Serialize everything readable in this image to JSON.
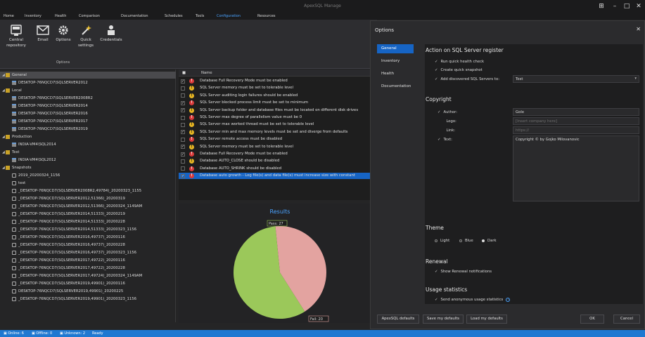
{
  "app": {
    "title": "ApexSQL Manage"
  },
  "menu": [
    "Home",
    "Inventory",
    "Health",
    "Comparison",
    "Documentation",
    "Schedules",
    "Tools",
    "Configuration",
    "Resources"
  ],
  "ribbon": {
    "buttons": [
      {
        "label_1": "Central",
        "label_2": "repository",
        "icon": "database-icon"
      },
      {
        "label_1": "Email",
        "label_2": "",
        "icon": "mail-icon"
      },
      {
        "label_1": "Options",
        "label_2": "",
        "icon": "gear-icon"
      },
      {
        "label_1": "Quick",
        "label_2": "settings",
        "icon": "magic-wand-icon"
      },
      {
        "label_1": "Credentials",
        "label_2": "",
        "icon": "user-key-icon"
      }
    ],
    "group_label": "Options"
  },
  "tree": [
    {
      "label": "General",
      "type": "group",
      "indent": 0,
      "selected": true
    },
    {
      "label": "DESKTOP-76NQCD7\\SQLSERVER2012",
      "type": "server",
      "indent": 1
    },
    {
      "label": "Local",
      "type": "group",
      "indent": 0
    },
    {
      "label": "DESKTOP-76NQCD7\\SQLSERVER2008R2",
      "type": "server",
      "indent": 1
    },
    {
      "label": "DESKTOP-76NQCD7\\SQLSERVER2014",
      "type": "server",
      "indent": 1
    },
    {
      "label": "DESKTOP-76NQCD7\\SQLSERVER2016",
      "type": "server",
      "indent": 1
    },
    {
      "label": "DESKTOP-76NQCD7\\SQLSERVER2017",
      "type": "server",
      "indent": 1
    },
    {
      "label": "DESKTOP-76NQCD7\\SQLSERVER2019",
      "type": "server",
      "indent": 1
    },
    {
      "label": "Production",
      "type": "group",
      "indent": 0
    },
    {
      "label": "INDIA-VM4\\SQL2014",
      "type": "server",
      "indent": 1
    },
    {
      "label": "Test",
      "type": "group",
      "indent": 0
    },
    {
      "label": "INDIA-VM4\\SQL2012",
      "type": "server",
      "indent": 1
    },
    {
      "label": "Snapshots",
      "type": "group",
      "indent": 0
    },
    {
      "label": "2019_20200324_1156",
      "type": "snapshot",
      "indent": 1
    },
    {
      "label": "test",
      "type": "snapshot",
      "indent": 1
    },
    {
      "label": "_DESKTOP-76NQCD7(SQLSERVER2008R2,49784)_20200323_1155",
      "type": "snapshot",
      "indent": 1
    },
    {
      "label": "_DESKTOP-76NQCD7(SQLSERVER2012,51366)_20200319",
      "type": "snapshot",
      "indent": 1
    },
    {
      "label": "_DESKTOP-76NQCD7(SQLSERVER2012,51366)_20200324_1149AM",
      "type": "snapshot",
      "indent": 1
    },
    {
      "label": "_DESKTOP-76NQCD7(SQLSERVER2014,51333)_20200219",
      "type": "snapshot",
      "indent": 1
    },
    {
      "label": "_DESKTOP-76NQCD7(SQLSERVER2014,51333)_20200228",
      "type": "snapshot",
      "indent": 1
    },
    {
      "label": "_DESKTOP-76NQCD7(SQLSERVER2014,51333)_20200323_1156",
      "type": "snapshot",
      "indent": 1
    },
    {
      "label": "_DESKTOP-76NQCD7(SQLSERVER2016,49737)_20200116",
      "type": "snapshot",
      "indent": 1
    },
    {
      "label": "_DESKTOP-76NQCD7(SQLSERVER2016,49737)_20200228",
      "type": "snapshot",
      "indent": 1
    },
    {
      "label": "_DESKTOP-76NQCD7(SQLSERVER2016,49737)_20200323_1156",
      "type": "snapshot",
      "indent": 1
    },
    {
      "label": "_DESKTOP-76NQCD7(SQLSERVER2017,49722)_20200116",
      "type": "snapshot",
      "indent": 1
    },
    {
      "label": "_DESKTOP-76NQCD7(SQLSERVER2017,49722)_20200228",
      "type": "snapshot",
      "indent": 1
    },
    {
      "label": "_DESKTOP-76NQCD7(SQLSERVER2017,49724)_20200324_1149AM",
      "type": "snapshot",
      "indent": 1
    },
    {
      "label": "_DESKTOP-76NQCD7(SQLSERVER2019,49901)_20200116",
      "type": "snapshot",
      "indent": 1
    },
    {
      "label": "DESKTOP-76NQCD7(SQLSERVER2019,49901)_20200225",
      "type": "snapshot",
      "indent": 1
    },
    {
      "label": "_DESKTOP-76NQCD7(SQLSERVER2019,49901)_20200323_1156",
      "type": "snapshot",
      "indent": 1
    }
  ],
  "grid": {
    "header_name": "Name",
    "rows": [
      {
        "checked": true,
        "severity": "high",
        "name": "Database Full Recovery Mode must be enabled"
      },
      {
        "checked": false,
        "severity": "med",
        "name": "SQL Server memory must be set to tolerable level"
      },
      {
        "checked": false,
        "severity": "med",
        "name": "SQL Server auditing login failures should be enabled"
      },
      {
        "checked": true,
        "severity": "high",
        "name": "SQL Server blocked process limit must be set to minimum"
      },
      {
        "checked": true,
        "severity": "med",
        "name": "SQL Server backup folder and database files must be located on different disk drives"
      },
      {
        "checked": false,
        "severity": "high",
        "name": "SQL Server max degree of parallelism value must be 0"
      },
      {
        "checked": false,
        "severity": "med",
        "name": "SQL Server max worked thread must be set to tolerable level"
      },
      {
        "checked": true,
        "severity": "med",
        "name": "SQL Server min and max memory levels must be set and diverge from defaults"
      },
      {
        "checked": false,
        "severity": "high",
        "name": "SQL Server remote access must be disabled"
      },
      {
        "checked": true,
        "severity": "med",
        "name": "SQL Server memory must be set to tolerable level"
      },
      {
        "checked": true,
        "severity": "high",
        "name": "Database Full Recovery Mode must be enabled"
      },
      {
        "checked": false,
        "severity": "med",
        "name": "Database AUTO_CLOSE should be disabled"
      },
      {
        "checked": false,
        "severity": "high",
        "name": "Database AUTO_SHRINK should be disabled"
      },
      {
        "checked": true,
        "severity": "high",
        "name": "Database auto growth - Log file(s) and data file(s) must increase size with constant",
        "selected": true
      }
    ]
  },
  "chart_data": {
    "type": "pie",
    "title": "Results",
    "labels": [
      "Pass",
      "Fail"
    ],
    "values": [
      27,
      20
    ],
    "slice_labels": [
      "Pass: 27",
      "Fail: 20"
    ],
    "colors": [
      "#9bc85a",
      "#e3a3a0"
    ]
  },
  "statusbar": {
    "items": [
      "Online: 6",
      "Offline: 0",
      "Unknown: 2",
      "Ready"
    ]
  },
  "dialog": {
    "title": "Options",
    "nav": [
      "General",
      "Inventory",
      "Health",
      "Documentation"
    ],
    "section_register": "Action on SQL Server register",
    "opt_health_check": "Run quick health check",
    "opt_snapshot": "Create quick snapshot",
    "opt_add_servers": "Add discovered SQL Servers to:",
    "add_servers_value": "Test",
    "section_copyright": "Copyright",
    "author_label": "Author:",
    "author_value": "Gole",
    "logo_label": "Logo:",
    "logo_placeholder": "[Insert company here]",
    "link_label": "Link:",
    "link_placeholder": "https://",
    "text_label": "Text:",
    "text_value": "Copyright © by Gojko Milovanovic",
    "section_theme": "Theme",
    "theme_options": [
      "Light",
      "Blue",
      "Dark"
    ],
    "theme_selected": "Dark",
    "section_renewal": "Renewal",
    "opt_renewal": "Show Renewal notifications",
    "section_usage": "Usage statistics",
    "opt_usage": "Send anonymous usage statistics",
    "buttons": {
      "apex_defaults": "ApexSQL defaults",
      "save_defaults": "Save my defaults",
      "load_defaults": "Load my defaults",
      "ok": "OK",
      "cancel": "Cancel"
    }
  }
}
